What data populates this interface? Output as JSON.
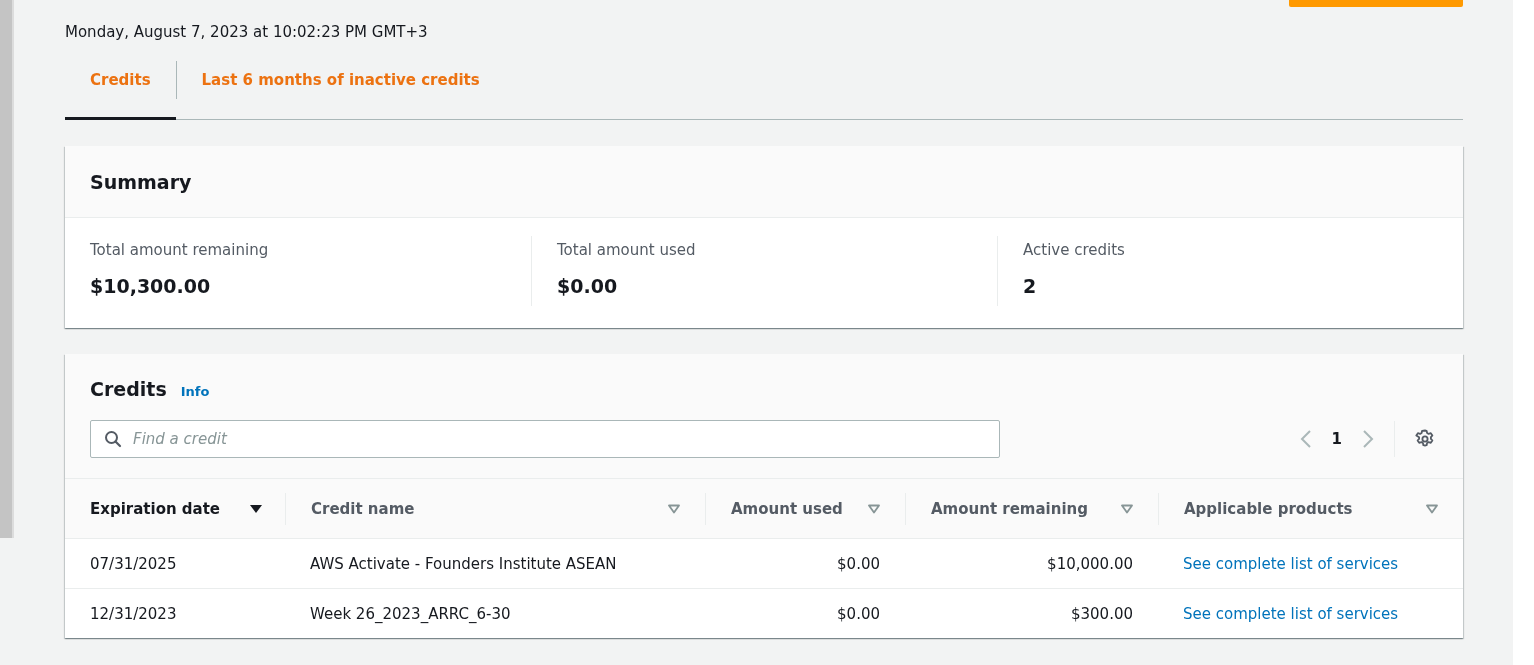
{
  "header": {
    "timestamp": "Monday, August 7, 2023 at 10:02:23 PM GMT+3"
  },
  "tabs": [
    {
      "label": "Credits",
      "selected": true
    },
    {
      "label": "Last 6 months of inactive credits",
      "selected": false
    }
  ],
  "summary": {
    "title": "Summary",
    "metrics": [
      {
        "label": "Total amount remaining",
        "value": "$10,300.00"
      },
      {
        "label": "Total amount used",
        "value": "$0.00"
      },
      {
        "label": "Active credits",
        "value": "2"
      }
    ]
  },
  "credits": {
    "title": "Credits",
    "info": "Info",
    "search": {
      "placeholder": "Find a credit"
    },
    "pagination": {
      "page": "1"
    },
    "table": {
      "columns": [
        {
          "label": "Expiration date",
          "sorted": true,
          "kind": "text"
        },
        {
          "label": "Credit name",
          "sorted": false,
          "kind": "text"
        },
        {
          "label": "Amount used",
          "sorted": false,
          "kind": "amount"
        },
        {
          "label": "Amount remaining",
          "sorted": false,
          "kind": "amount"
        },
        {
          "label": "Applicable products",
          "sorted": false,
          "kind": "link"
        }
      ],
      "rows": [
        [
          "07/31/2025",
          "AWS Activate - Founders Institute ASEAN",
          "$0.00",
          "$10,000.00",
          "See complete list of services"
        ],
        [
          "12/31/2023",
          "Week 26_2023_ARRC_6-30",
          "$0.00",
          "$300.00",
          "See complete list of services"
        ]
      ]
    }
  }
}
